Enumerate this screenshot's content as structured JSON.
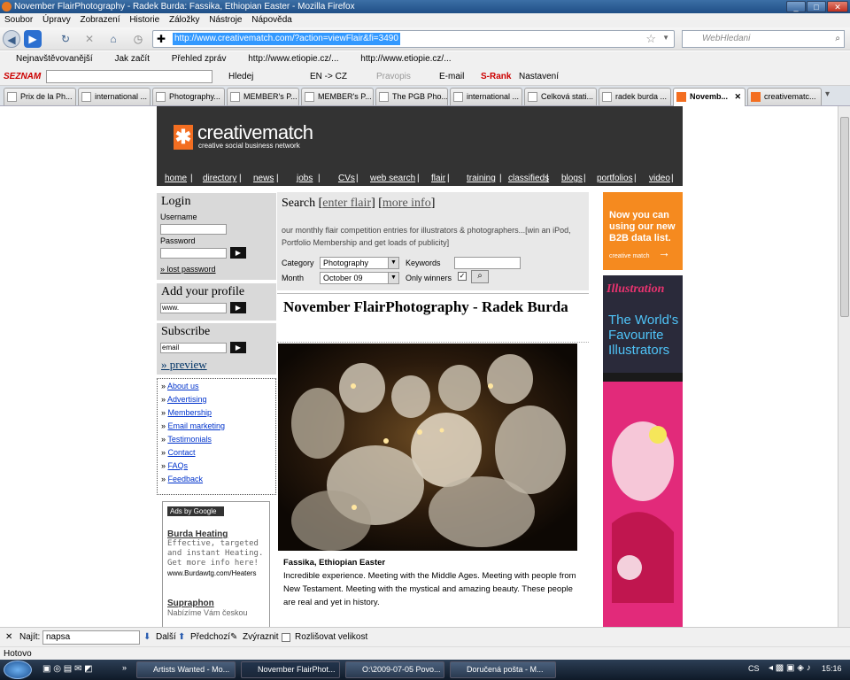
{
  "window": {
    "title": "November FlairPhotography - Radek Burda: Fassika, Ethiopian Easter - Mozilla Firefox"
  },
  "menu": [
    "Soubor",
    "Úpravy",
    "Zobrazení",
    "Historie",
    "Záložky",
    "Nástroje",
    "Nápověda"
  ],
  "nav": {
    "url": "http://www.creativematch.com/?action=viewFlair&fi=3490",
    "search_placeholder": "WebHledani"
  },
  "bookmarks": [
    "Nejnavštěvovanější",
    "Jak začít",
    "Přehled zpráv",
    "http://www.etiopie.cz/...",
    "http://www.etiopie.cz/..."
  ],
  "seznam": {
    "logo": "SEZNAM",
    "hledej": "Hledej",
    "translate": "EN -> CZ",
    "pravopis": "Pravopis",
    "email": "E-mail",
    "srank": "S-Rank",
    "nastaveni": "Nastavení"
  },
  "tabs": [
    "Prix de la Ph...",
    "international ...",
    "Photography...",
    "MEMBER's P...",
    "MEMBER's P...",
    "The PGB Pho...",
    "international ...",
    "Celková stati...",
    "radek burda ...",
    "Novemb...",
    "creativematc..."
  ],
  "site": {
    "logo": "creativematch",
    "tagline": "creative social business network",
    "topnav": [
      "home",
      "directory",
      "news",
      "jobs",
      "CVs",
      "web search",
      "flair",
      "training",
      "classifieds",
      "blogs",
      "portfolios",
      "video"
    ],
    "login": {
      "title": "Login",
      "username_label": "Username",
      "password_label": "Password",
      "lost": "» lost password"
    },
    "profile": {
      "title": "Add your profile",
      "value": "www."
    },
    "subscribe": {
      "title": "Subscribe",
      "value": "email",
      "preview": "» preview"
    },
    "links": [
      "About us",
      "Advertising",
      "Membership",
      "Email marketing",
      "Testimonials",
      "Contact",
      "FAQs",
      "Feedback"
    ],
    "ads": {
      "badge": "Ads by Google",
      "ad1_title": "Burda Heating",
      "ad1_text": "Effective, targeted and instant Heating. Get more info here!",
      "ad1_url": "www.Burdawtg.com/Heaters",
      "ad2_title": "Supraphon",
      "ad2_text": "Nabízíme Vám českou"
    },
    "search": {
      "title": "Search",
      "enter": "enter flair",
      "more": "more info",
      "desc": "our monthly flair competition entries for illustrators & photographers...[win an iPod, Portfolio Membership and get loads of publicity]",
      "category_label": "Category",
      "category_value": "Photography",
      "month_label": "Month",
      "month_value": "October 09",
      "keywords_label": "Keywords",
      "winners_label": "Only winners"
    },
    "title": "November FlairPhotography - Radek Burda",
    "caption_title": "Fassika, Ethiopian Easter",
    "caption_text": "Incredible experience. Meeting with the Middle Ages. Meeting with people from New Testament. Meeting with the mystical and amazing beauty. These people are real and yet in history.",
    "right_ad1": {
      "text": "Now you can using our new B2B data list.",
      "brand": "creative match"
    },
    "right_ad2": {
      "brand": "Illustration",
      "text": "The World's Favourite Illustrators"
    }
  },
  "findbar": {
    "label": "Najít:",
    "value": "napsa",
    "next": "Další",
    "prev": "Předchozí",
    "highlight": "Zvýraznit",
    "case": "Rozlišovat velikost"
  },
  "status": "Hotovo",
  "taskbar": {
    "items": [
      "Artists Wanted - Mo...",
      "November FlairPhot...",
      "O:\\2009-07-05 Povo...",
      "Doručená pošta - M..."
    ],
    "lang": "CS",
    "time": "15:16"
  }
}
